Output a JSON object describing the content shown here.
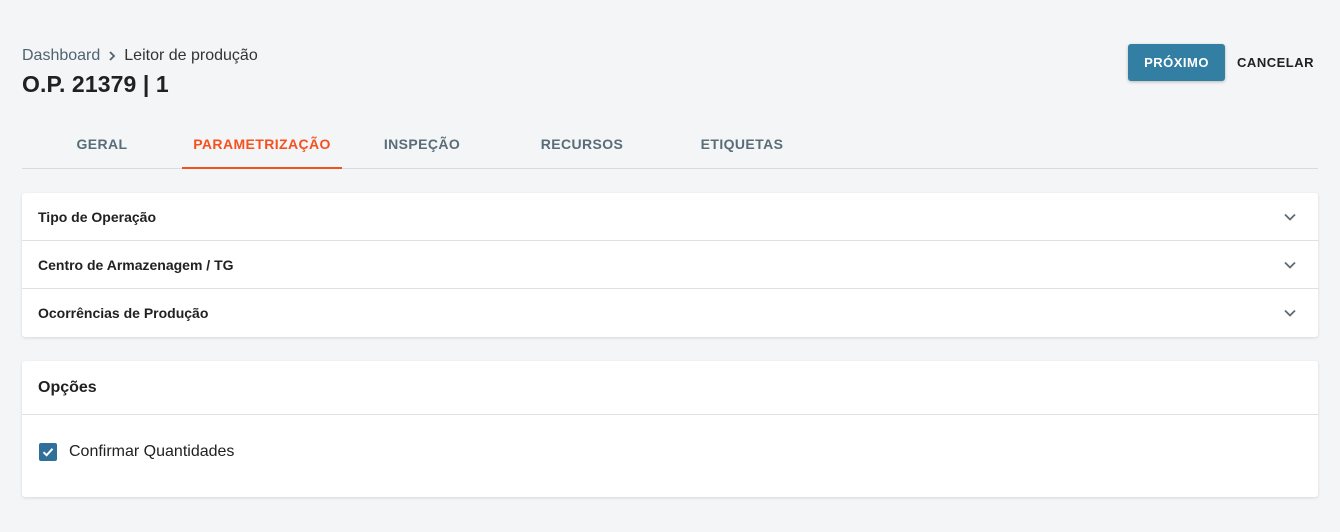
{
  "breadcrumb": {
    "home": "Dashboard",
    "current": "Leitor de produção"
  },
  "page_title": "O.P. 21379 | 1",
  "actions": {
    "next": "PRÓXIMO",
    "cancel": "CANCELAR"
  },
  "tabs": [
    {
      "label": "GERAL",
      "active": false
    },
    {
      "label": "PARAMETRIZAÇÃO",
      "active": true
    },
    {
      "label": "INSPEÇÃO",
      "active": false
    },
    {
      "label": "RECURSOS",
      "active": false
    },
    {
      "label": "ETIQUETAS",
      "active": false
    }
  ],
  "accordion": [
    {
      "label": "Tipo de Operação",
      "icon": "chevron-down-icon"
    },
    {
      "label": "Centro de Armazenagem / TG",
      "icon": "chevron-down-icon"
    },
    {
      "label": "Ocorrências de Produção",
      "icon": "chevron-down-icon"
    }
  ],
  "options": {
    "title": "Opções",
    "items": [
      {
        "label": "Confirmar Quantidades",
        "checked": true
      }
    ]
  },
  "colors": {
    "primary": "#337ea3",
    "accent": "#f4511e",
    "background": "#f4f5f7",
    "checkbox": "#2f6f9a"
  }
}
